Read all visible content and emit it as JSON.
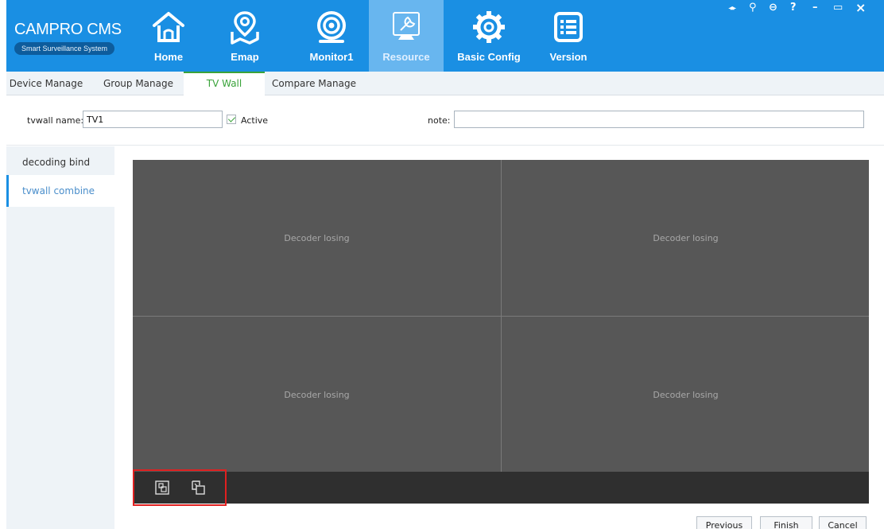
{
  "app": {
    "title": "CAMPRO CMS",
    "subtitle": "Smart Surveillance System"
  },
  "nav": {
    "items": [
      {
        "label": "Home",
        "icon": "home-icon"
      },
      {
        "label": "Emap",
        "icon": "map-pin-icon"
      },
      {
        "label": "Monitor1",
        "icon": "camera-lens-icon"
      },
      {
        "label": "Resource",
        "icon": "wrench-monitor-icon",
        "active": true
      },
      {
        "label": "Basic Config",
        "icon": "gear-icon"
      },
      {
        "label": "Version",
        "icon": "list-icon"
      }
    ]
  },
  "window_controls": {
    "pin": "🠽",
    "user": "⚲",
    "lock": "⊖",
    "help": "?",
    "minimize": "–",
    "maximize": "▭",
    "close": "×"
  },
  "tabs": [
    {
      "label": "Device Manage"
    },
    {
      "label": "Group Manage"
    },
    {
      "label": "TV Wall",
      "active": true
    },
    {
      "label": "Compare Manage"
    }
  ],
  "form": {
    "name_label": "tvwall name:",
    "name_value": "TV1",
    "active_label": "Active",
    "active_checked": true,
    "note_label": "note:",
    "note_value": ""
  },
  "side_menu": [
    {
      "label": "decoding bind"
    },
    {
      "label": "tvwall combine",
      "active": true
    }
  ],
  "wall": {
    "cells": [
      {
        "text": "Decoder losing"
      },
      {
        "text": "Decoder losing"
      },
      {
        "text": "Decoder losing"
      },
      {
        "text": "Decoder losing"
      }
    ],
    "toolbar_icons": [
      "merge-screens-icon",
      "split-screens-icon"
    ]
  },
  "buttons": {
    "previous": "Previous",
    "finish": "Finish",
    "cancel": "Cancel"
  },
  "colors": {
    "header": "#1a8fe3",
    "active_nav": "#68b6ef",
    "active_tab": "#3aa33a",
    "wall_bg": "#575757",
    "highlight": "#e02020"
  }
}
